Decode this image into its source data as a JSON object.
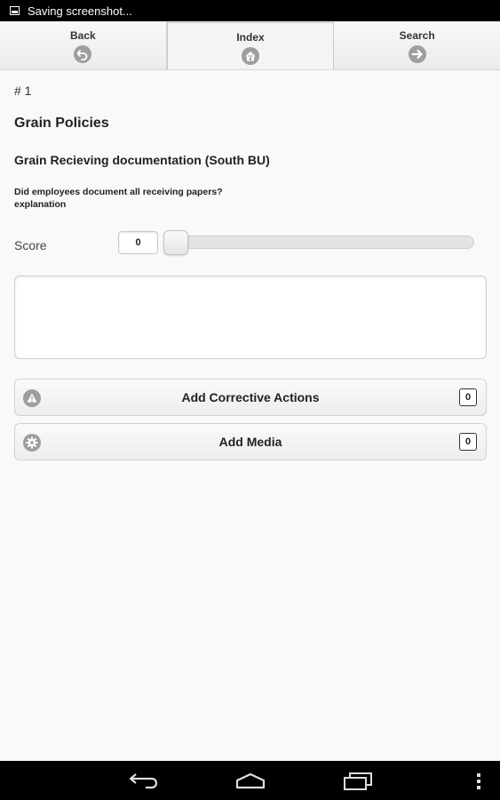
{
  "status_bar": {
    "icon": "screenshot-icon",
    "text": "Saving screenshot..."
  },
  "nav": {
    "back_label": "Back",
    "back_icon": "back-arrow-icon",
    "index_label": "Index",
    "index_icon": "home-icon",
    "search_label": "Search",
    "search_icon": "forward-arrow-icon"
  },
  "content": {
    "question_number": "# 1",
    "policy_title": "Grain Policies",
    "section_title": "Grain Recieving documentation (South BU)",
    "question_line1": "Did employees document all receiving papers?",
    "question_line2": "explanation",
    "score_label": "Score",
    "score_value": "0",
    "notes_value": ""
  },
  "actions": {
    "corrective_label": "Add Corrective Actions",
    "corrective_icon": "alert-icon",
    "corrective_count": "0",
    "media_label": "Add Media",
    "media_icon": "gear-icon",
    "media_count": "0"
  },
  "system_nav": {
    "back_icon": "system-back-icon",
    "home_icon": "system-home-icon",
    "recents_icon": "system-recents-icon",
    "menu_icon": "overflow-menu-icon"
  },
  "colors": {
    "icon_gray": "#9e9e9e",
    "bar_black": "#000000"
  }
}
